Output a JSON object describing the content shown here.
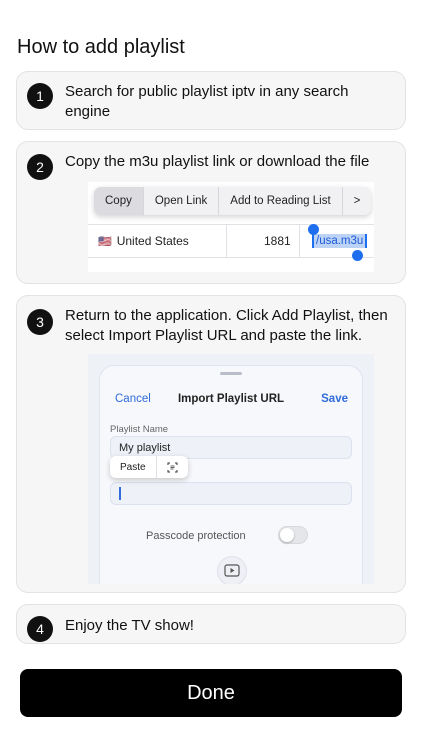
{
  "page": {
    "title": "How to add playlist"
  },
  "steps": [
    {
      "number": "1",
      "text": "Search for public playlist iptv in any search engine"
    },
    {
      "number": "2",
      "text": "Copy the m3u playlist link or download the file"
    },
    {
      "number": "3",
      "text": "Return to the application. Click Add Playlist, then select Import Playlist URL and paste the link."
    },
    {
      "number": "4",
      "text": "Enjoy the TV show!"
    }
  ],
  "step2_screenshot": {
    "context_menu": [
      "Copy",
      "Open Link",
      "Add to Reading List",
      ">"
    ],
    "row": {
      "flag": "🇺🇸",
      "country": "United States",
      "count": "1881",
      "url": "/usa.m3u"
    }
  },
  "step3_screenshot": {
    "cancel": "Cancel",
    "title": "Import Playlist URL",
    "save": "Save",
    "field_label": "Playlist Name",
    "field_value": "My playlist",
    "paste": "Paste",
    "passcode_label": "Passcode protection"
  },
  "footer": {
    "done_label": "Done"
  },
  "colors": {
    "primary": "#000000",
    "accent_blue": "#2f6bd9",
    "card_bg": "#f6f6f7"
  }
}
